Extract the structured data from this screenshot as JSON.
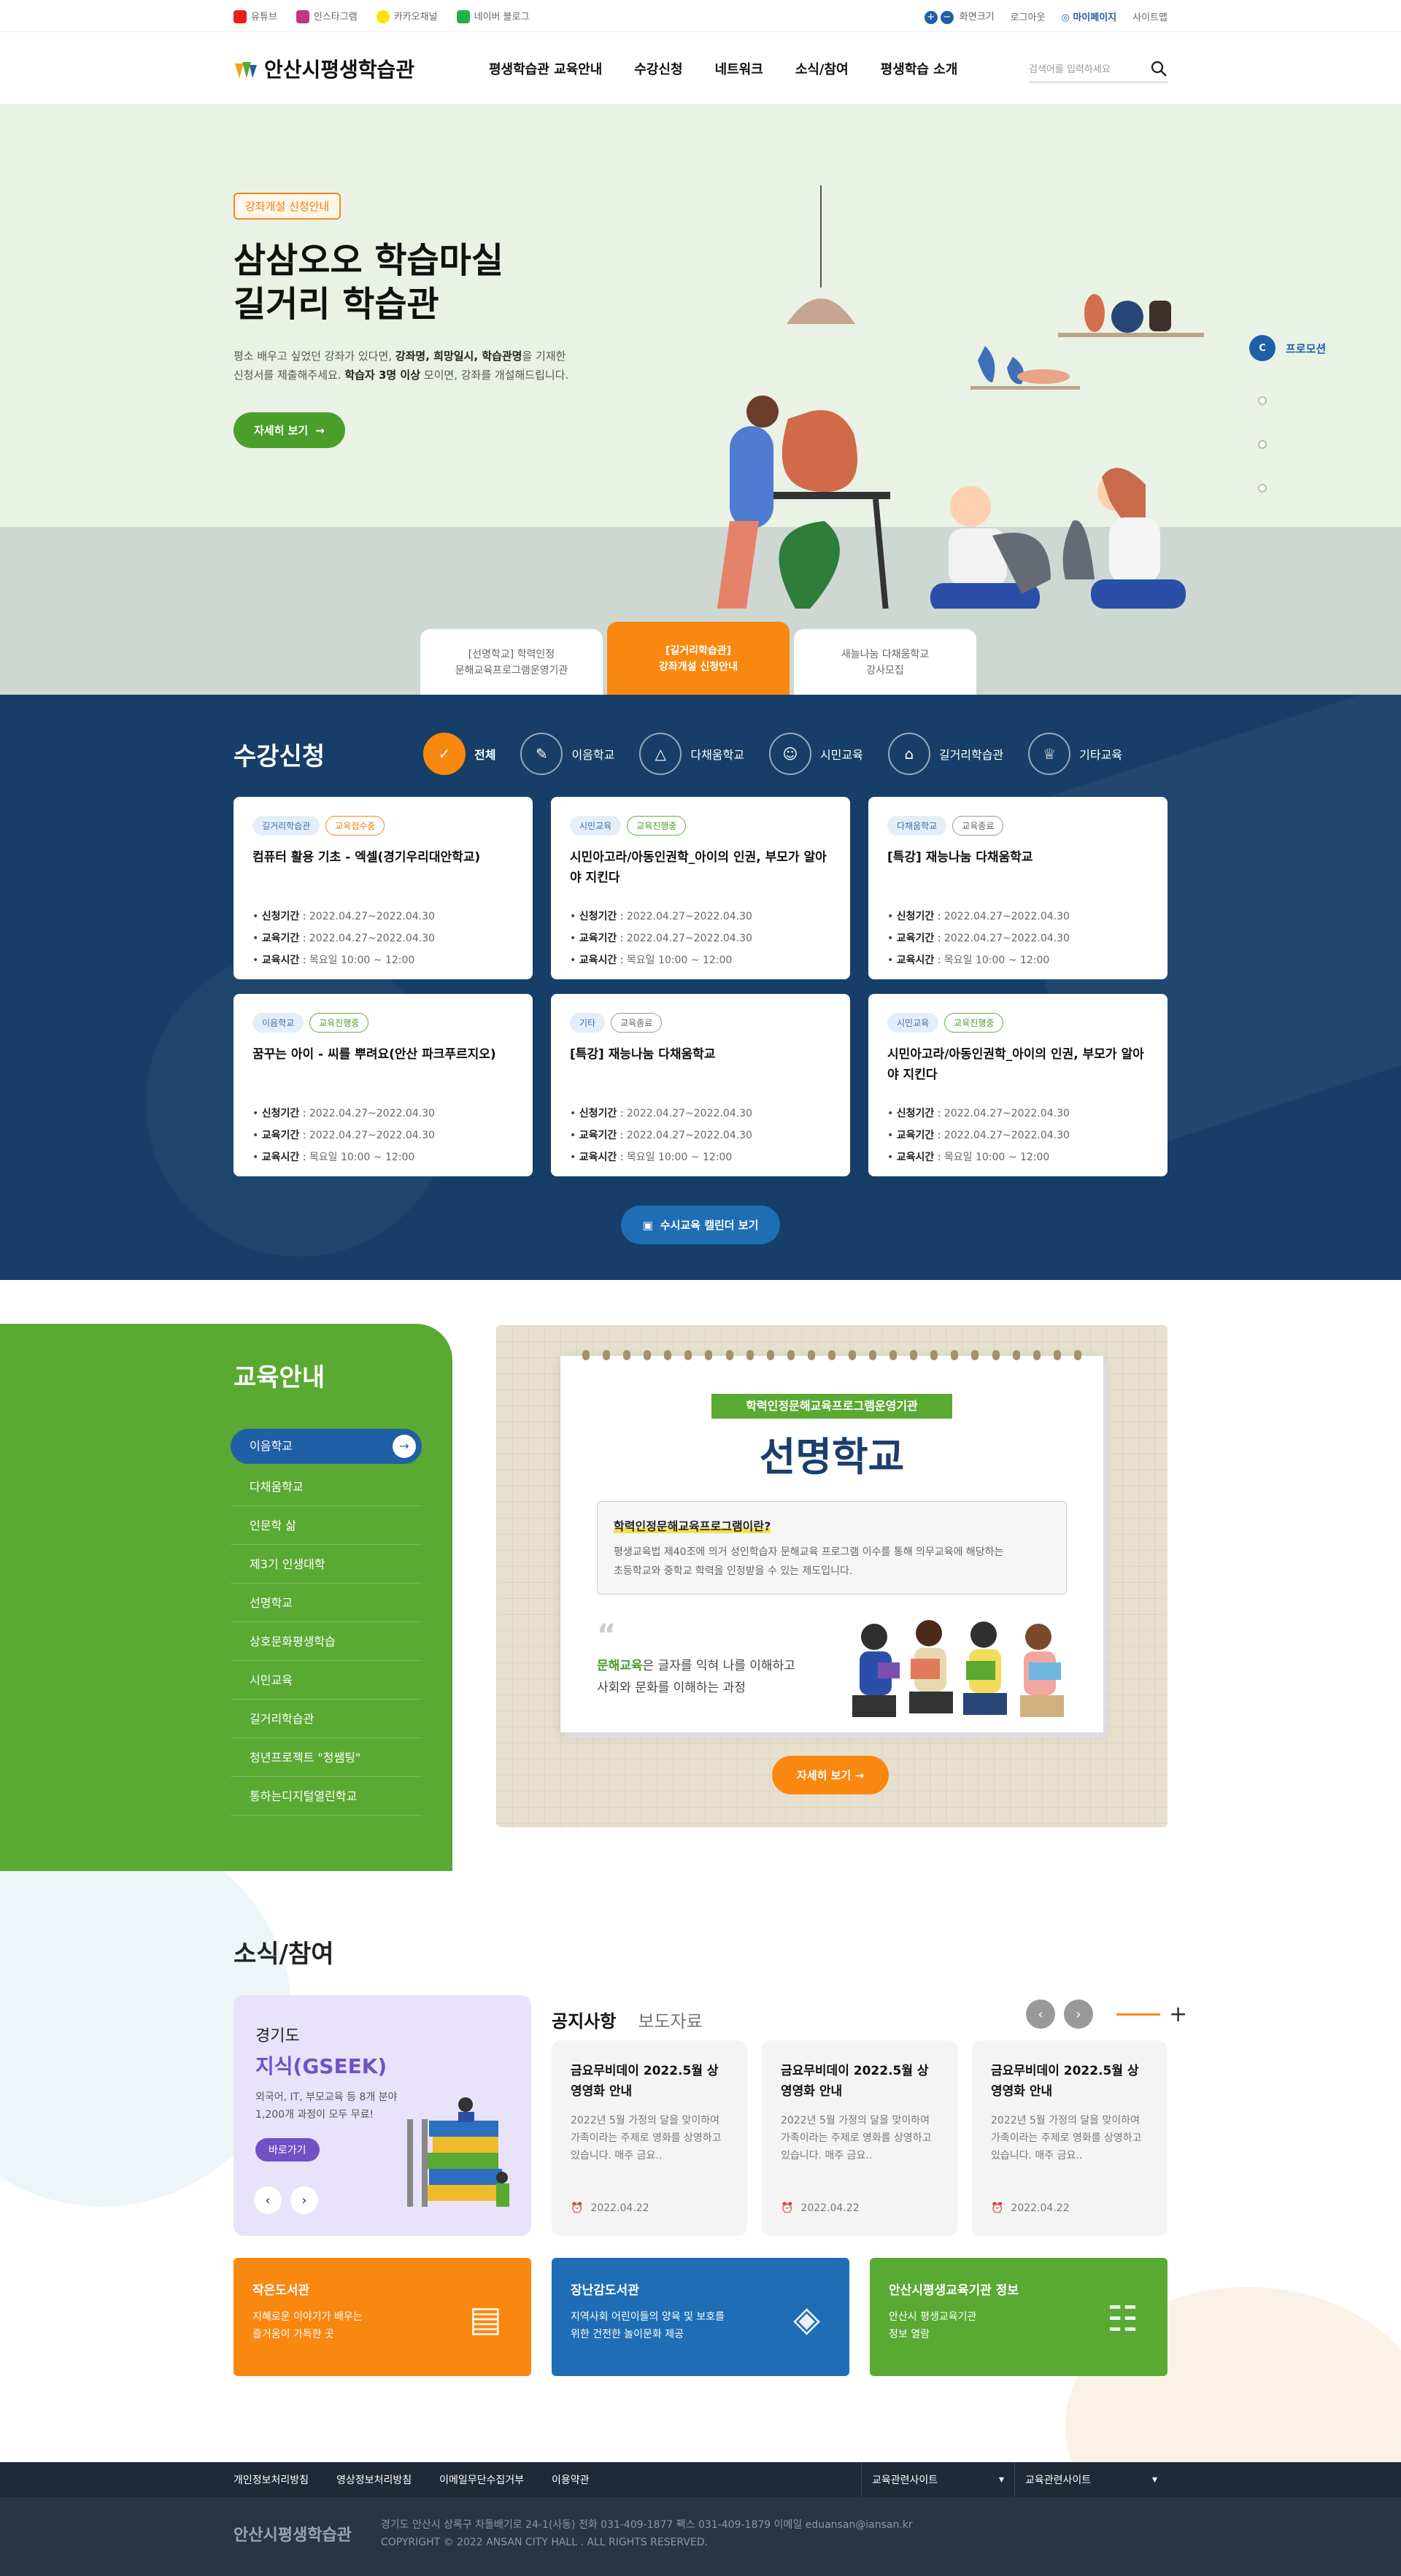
{
  "util": {
    "sns": [
      {
        "label": "유튜브",
        "color": "#e62117"
      },
      {
        "label": "인스타그램",
        "color": "#c13584"
      },
      {
        "label": "카카오채널",
        "color": "#fee500"
      },
      {
        "label": "네이버 블로그",
        "color": "#22b04a"
      }
    ],
    "fontsize_label": "화면크기",
    "logout": "로그아웃",
    "mypage": "마이페이지",
    "sitemap": "사이트맵"
  },
  "header": {
    "logo": "안산시평생학습관",
    "menu": [
      "평생학습관 교육안내",
      "수강신청",
      "네트워크",
      "소식/참여",
      "평생학습 소개"
    ],
    "search_placeholder": "검색어를 입력하세요"
  },
  "hero": {
    "badge": "강좌개설 신청안내",
    "title1": "삼삼오오 학습마실",
    "title2": "길거리 학습관",
    "desc1_a": "평소 배우고 싶었던 강좌가 있다면,",
    "desc1_b": "강좌명, 희망일시, 학습관명",
    "desc1_c": "을 기재한",
    "desc2_a": "신청서를 제출해주세요.",
    "desc2_b": "학습자 3명 이상",
    "desc2_c": "모이면, 강좌를 개설해드립니다.",
    "button": "자세히 보기",
    "promo": "프로모션",
    "tabs": [
      {
        "l1": "[선명학교] 학력인정",
        "l2": "문해교육프로그램운영기관"
      },
      {
        "l1": "[길거리학습관]",
        "l2": "강좌개설 신청안내"
      },
      {
        "l1": "새늘나눔 다채움학교",
        "l2": "강사모집"
      }
    ]
  },
  "courses": {
    "title": "수강신청",
    "categories": [
      "전체",
      "이음학교",
      "다채움학교",
      "시민교육",
      "길거리학습관",
      "기타교육"
    ],
    "label_apply": "신청기간",
    "label_edu": "교육기간",
    "label_time": "교육시간",
    "items": [
      {
        "tag1": "길거리학습관",
        "tag2": "교육접수중",
        "title": "컴퓨터 활용 기초 - 엑셀(경기우리대안학교)",
        "apply": "2022.04.27~2022.04.30",
        "period": "2022.04.27~2022.04.30",
        "time": "목요일 10:00 ~ 12:00"
      },
      {
        "tag1": "시민교육",
        "tag2": "교육진행중",
        "title": "시민아고라/아동인권학_아이의 인권, 부모가 알아야 지킨다",
        "apply": "2022.04.27~2022.04.30",
        "period": "2022.04.27~2022.04.30",
        "time": "목요일 10:00 ~ 12:00"
      },
      {
        "tag1": "다채움학교",
        "tag2": "교육종료",
        "title": "[특강] 재능나눔 다채움학교",
        "apply": "2022.04.27~2022.04.30",
        "period": "2022.04.27~2022.04.30",
        "time": "목요일 10:00 ~ 12:00"
      },
      {
        "tag1": "이음학교",
        "tag2": "교육진행중",
        "title": "꿈꾸는 아이 - 씨를 뿌려요(안산 파크푸르지오)",
        "apply": "2022.04.27~2022.04.30",
        "period": "2022.04.27~2022.04.30",
        "time": "목요일 10:00 ~ 12:00"
      },
      {
        "tag1": "기타",
        "tag2": "교육종료",
        "title": "[특강] 재능나눔 다채움학교",
        "apply": "2022.04.27~2022.04.30",
        "period": "2022.04.27~2022.04.30",
        "time": "목요일 10:00 ~ 12:00"
      },
      {
        "tag1": "시민교육",
        "tag2": "교육진행중",
        "title": "시민아고라/아동인권학_아이의 인권, 부모가 알아야 지킨다",
        "apply": "2022.04.27~2022.04.30",
        "period": "2022.04.27~2022.04.30",
        "time": "목요일 10:00 ~ 12:00"
      }
    ],
    "calendar_button": "수시교육 캘린더 보기"
  },
  "edu": {
    "title": "교육안내",
    "items": [
      "이음학교",
      "다채움학교",
      "인문학 삶",
      "제3기 인생대학",
      "선명학교",
      "상호문화평생학습",
      "시민교육",
      "길거리학습관",
      "청년프로젝트 \"청쌤팅\"",
      "통하는디지털열린학교"
    ],
    "ribbon": "학력인정문해교육프로그램운영기관",
    "school": "선명학교",
    "box_title": "학력인정문해교육프로그램이란?",
    "box_text1": "평생교육법 제40조에 의거 성인학습자 문해교육 프로그램 이수를 통해 의무교육에 해당하는",
    "box_text2": "초등학교와 중학교 학력을 인정받을 수 있는 제도입니다.",
    "quote_key": "문해교육",
    "quote_rest": "은 글자를 익혀 나를 이해하고",
    "quote_line2": "사회와 문화를 이해하는 과정",
    "button": "자세히 보기"
  },
  "news": {
    "title": "소식/참여",
    "gseek": {
      "t1": "경기도",
      "t2": "지식(GSEEK)",
      "d1": "외국어, IT, 부모교육 등 8개 분야",
      "d2": "1,200개 과정이 모두 무료!",
      "go": "바로가기"
    },
    "tabs": [
      "공지사항",
      "보도자료"
    ],
    "cards": [
      {
        "title": "금요무비데이 2022.5월 상영영화 안내",
        "desc": "2022년 5월 가정의 달을 맞이하여 가족이라는 주제로 영화를 상영하고 있습니다. 매주 금요..",
        "date": "2022.04.22"
      },
      {
        "title": "금요무비데이 2022.5월 상영영화 안내",
        "desc": "2022년 5월 가정의 달을 맞이하여 가족이라는 주제로 영화를 상영하고 있습니다. 매주 금요..",
        "date": "2022.04.22"
      },
      {
        "title": "금요무비데이 2022.5월 상영영화 안내",
        "desc": "2022년 5월 가정의 달을 맞이하여 가족이라는 주제로 영화를 상영하고 있습니다. 매주 금요..",
        "date": "2022.04.22"
      }
    ],
    "banners": [
      {
        "title": "작은도서관",
        "d1": "지혜로운 이야기가 배우는",
        "d2": "즐거움이 가득한 곳",
        "color": "#f8880f"
      },
      {
        "title": "장난감도서관",
        "d1": "지역사회 어린이들의 양육 및 보호를",
        "d2": "위한 건전한 놀이문화 제공",
        "color": "#1f6eb5"
      },
      {
        "title": "안산시평생교육기관 정보",
        "d1": "안산시 평생교육기관",
        "d2": "정보 열람",
        "color": "#5aa933"
      }
    ]
  },
  "footer": {
    "links": [
      "개인정보처리방침",
      "영상정보처리방침",
      "이메일무단수집거부",
      "이용약관"
    ],
    "selects": [
      "교육관련사이트",
      "교육관련사이트"
    ],
    "logo": "안산시평생학습관",
    "address": "경기도 안산시 상록구 차돌배기로 24-1(사동) 전화 031-409-1877 팩스 031-409-1879 이메일 eduansan@iansan.kr",
    "copyright": "COPYRIGHT © 2022 ANSAN CITY HALL . ALL RIGHTS RESERVED."
  }
}
